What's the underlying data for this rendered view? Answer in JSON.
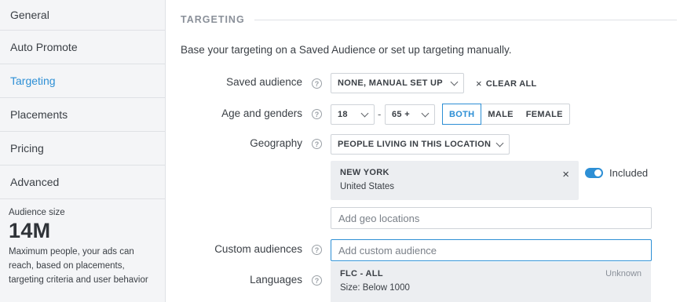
{
  "sidebar": {
    "items": [
      {
        "label": "General",
        "active": false
      },
      {
        "label": "Auto Promote",
        "active": false
      },
      {
        "label": "Targeting",
        "active": true
      },
      {
        "label": "Placements",
        "active": false
      },
      {
        "label": "Pricing",
        "active": false
      },
      {
        "label": "Advanced",
        "active": false
      }
    ],
    "audience": {
      "label": "Audience size",
      "value": "14M",
      "description": "Maximum people, your ads can reach, based on placements, targeting criteria and user behavior"
    }
  },
  "main": {
    "section_title": "TARGETING",
    "intro": "Base your targeting on a Saved Audience or set up targeting manually.",
    "help_glyph": "?",
    "saved_audience": {
      "label": "Saved audience",
      "value": "NONE, MANUAL SET UP",
      "clear_icon": "×",
      "clear_label": "CLEAR ALL"
    },
    "age_genders": {
      "label": "Age and genders",
      "age_min": "18",
      "separator": "-",
      "age_max": "65 +",
      "genders": [
        "BOTH",
        "MALE",
        "FEMALE"
      ],
      "selected_gender": "BOTH"
    },
    "geography": {
      "label": "Geography",
      "value": "PEOPLE LIVING IN THIS LOCATION",
      "location": {
        "name": "NEW YORK",
        "country": "United States",
        "remove_icon": "×"
      },
      "toggle_label": "Included",
      "toggle_on": true,
      "add_placeholder": "Add geo locations"
    },
    "custom_audiences": {
      "label": "Custom audiences",
      "placeholder": "Add custom audience",
      "result": {
        "name": "FLC - ALL",
        "size": "Size: Below 1000",
        "status": "Unknown"
      }
    },
    "languages": {
      "label": "Languages"
    }
  },
  "colors": {
    "accent": "#2d8fd5",
    "sidebar_bg": "#f4f5f7",
    "card_bg": "#eceef1"
  }
}
